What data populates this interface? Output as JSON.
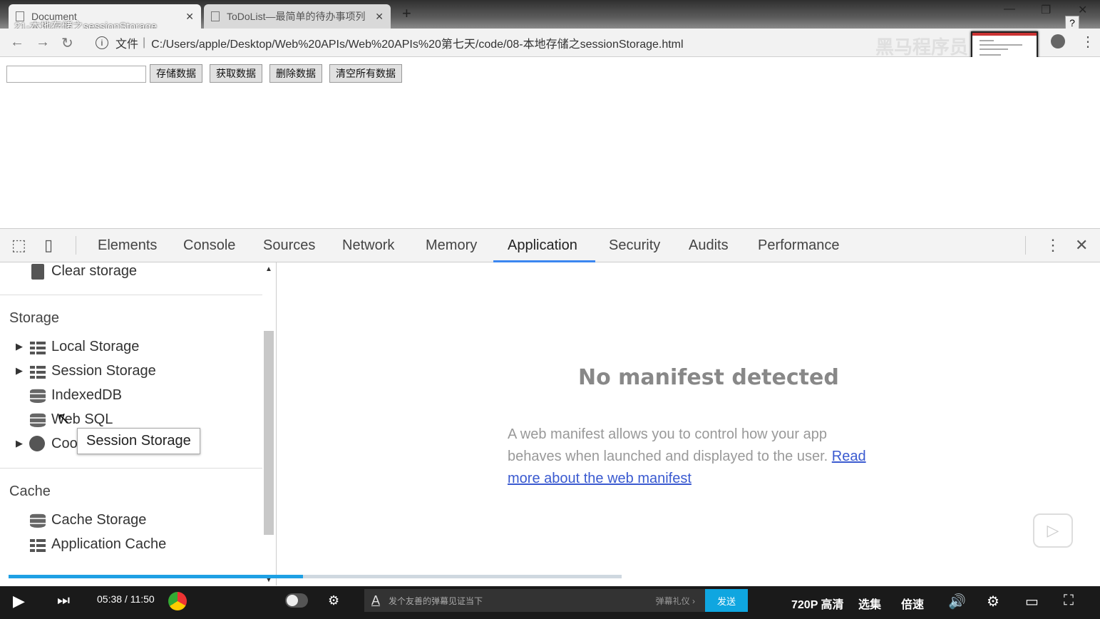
{
  "video_title": "21-本地存储之sessionStorage",
  "browser": {
    "tabs": [
      {
        "title": "Document",
        "active": true
      },
      {
        "title": "ToDoList—最简单的待办事项列",
        "active": false
      }
    ],
    "new_tab_label": "+",
    "address": {
      "scheme_label": "文件",
      "url": "C:/Users/apple/Desktop/Web%20APIs/Web%20APIs%20第七天/code/08-本地存储之sessionStorage.html"
    },
    "watermark": "黑马程序员"
  },
  "page": {
    "input_value": "",
    "buttons": [
      "存储数据",
      "获取数据",
      "删除数据",
      "清空所有数据"
    ]
  },
  "devtools": {
    "tabs": [
      "Elements",
      "Console",
      "Sources",
      "Network",
      "Memory",
      "Application",
      "Security",
      "Audits",
      "Performance"
    ],
    "active_tab": "Application",
    "sidebar": {
      "clear_storage": "Clear storage",
      "storage_header": "Storage",
      "storage_items": [
        "Local Storage",
        "Session Storage",
        "IndexedDB",
        "Web SQL",
        "Cookies"
      ],
      "cache_header": "Cache",
      "cache_items": [
        "Cache Storage",
        "Application Cache"
      ]
    },
    "tooltip": "Session Storage",
    "main": {
      "heading": "No manifest detected",
      "description": "A web manifest allows you to control how your app behaves when launched and displayed to the user.",
      "link": "Read more about the web manifest"
    }
  },
  "player": {
    "progress": 0.48,
    "current_time": "05:38",
    "total_time": "11:50",
    "danmu_placeholder": "发个友善的弹幕见证当下",
    "danmu_etiquette": "弹幕礼仪 ›",
    "send_label": "发送",
    "quality": "720P 高清",
    "episodes": "选集",
    "speed": "倍速",
    "accent_color": "#0fa6e0"
  }
}
